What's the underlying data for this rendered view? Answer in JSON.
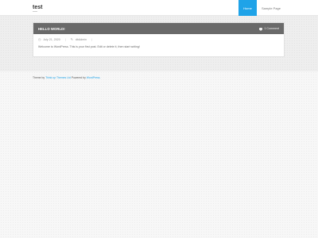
{
  "site": {
    "title": "test"
  },
  "nav": {
    "items": [
      {
        "label": "Home",
        "active": true
      },
      {
        "label": "Sample Page",
        "active": false
      }
    ]
  },
  "post": {
    "title": "HELLO WORLD!",
    "comments": "1 Comment",
    "date": "July 21, 2020",
    "author": "dbAdmin",
    "content": "Welcome to WordPress. This is your first post. Edit or delete it, then start writing!"
  },
  "footer": {
    "prefix": "Theme by",
    "theme_link": "Think up Themes Ltd",
    "middle": "Powered by",
    "wp_link": "WordPress."
  },
  "colors": {
    "accent": "#1fa3e8",
    "post_header": "#6a6a6a"
  }
}
